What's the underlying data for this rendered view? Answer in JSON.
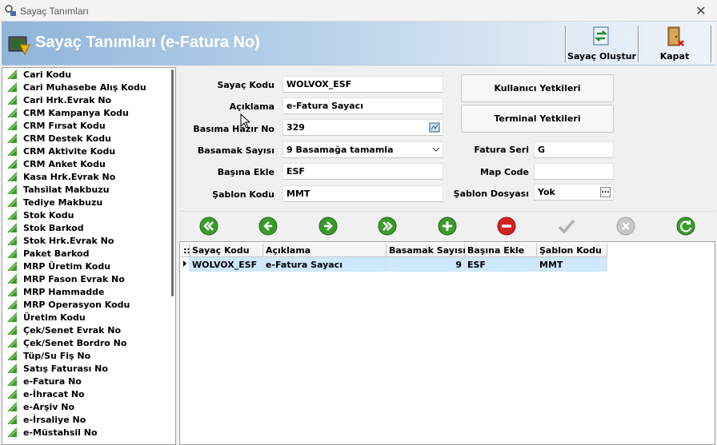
{
  "window": {
    "title": "Sayaç Tanımları"
  },
  "header": {
    "title": "Sayaç Tanımları (e-Fatura No)",
    "btn_create_label": "Sayaç Oluştur",
    "btn_close_label": "Kapat"
  },
  "sidebar": {
    "items": [
      "Cari Kodu",
      "Cari Muhasebe Alış Kodu",
      "Cari Hrk.Evrak No",
      "CRM Kampanya Kodu",
      "CRM Fırsat Kodu",
      "CRM Destek Kodu",
      "CRM Aktivite Kodu",
      "CRM Anket Kodu",
      "Kasa Hrk.Evrak No",
      "Tahsilat Makbuzu",
      "Tediye Makbuzu",
      "Stok Kodu",
      "Stok Barkod",
      "Stok Hrk.Evrak No",
      "Paket Barkod",
      "MRP Üretim Kodu",
      "MRP Fason Evrak No",
      "MRP Hammadde",
      "MRP Operasyon Kodu",
      "Üretim Kodu",
      "Çek/Senet Evrak No",
      "Çek/Senet Bordro No",
      "Tüp/Su Fiş No",
      "Satış Faturası No",
      "e-Fatura No",
      "e-İhracat No",
      "e-Arşiv No",
      "e-İrsaliye No",
      "e-Müstahsil No"
    ]
  },
  "form": {
    "sayac_kodu_label": "Sayaç Kodu",
    "sayac_kodu_value": "WOLVOX_ESF",
    "aciklama_label": "Açıklama",
    "aciklama_value": "e-Fatura Sayacı",
    "basima_hazir_label": "Basıma Hazır No",
    "basima_hazir_value": "329",
    "basamak_label": "Basamak Sayısı",
    "basamak_value": "9 Basamağa tamamla",
    "basina_ekle_label": "Başına Ekle",
    "basina_ekle_value": "ESF",
    "sablon_kodu_label": "Şablon Kodu",
    "sablon_kodu_value": "MMT",
    "kullanici_btn": "Kullanıcı Yetkileri",
    "terminal_btn": "Terminal Yetkileri",
    "fatura_seri_label": "Fatura Seri",
    "fatura_seri_value": "G",
    "map_code_label": "Map Code",
    "map_code_value": "",
    "sablon_dosyasi_label": "Şablon Dosyası",
    "sablon_dosyasi_value": "Yok",
    "ellipsis": "..."
  },
  "grid": {
    "indicator_header": "::",
    "columns": [
      "Sayaç Kodu",
      "Açıklama",
      "Basamak Sayısı",
      "Başına Ekle",
      "Şablon Kodu"
    ],
    "rows": [
      [
        "WOLVOX_ESF",
        "e-Fatura Sayacı",
        "9",
        "ESF",
        "MMT"
      ]
    ]
  },
  "colors": {
    "nav_green": "#3a9a2a",
    "nav_red": "#d42020",
    "nav_disabled": "#b0b0b0",
    "selection": "#cde8ff"
  }
}
